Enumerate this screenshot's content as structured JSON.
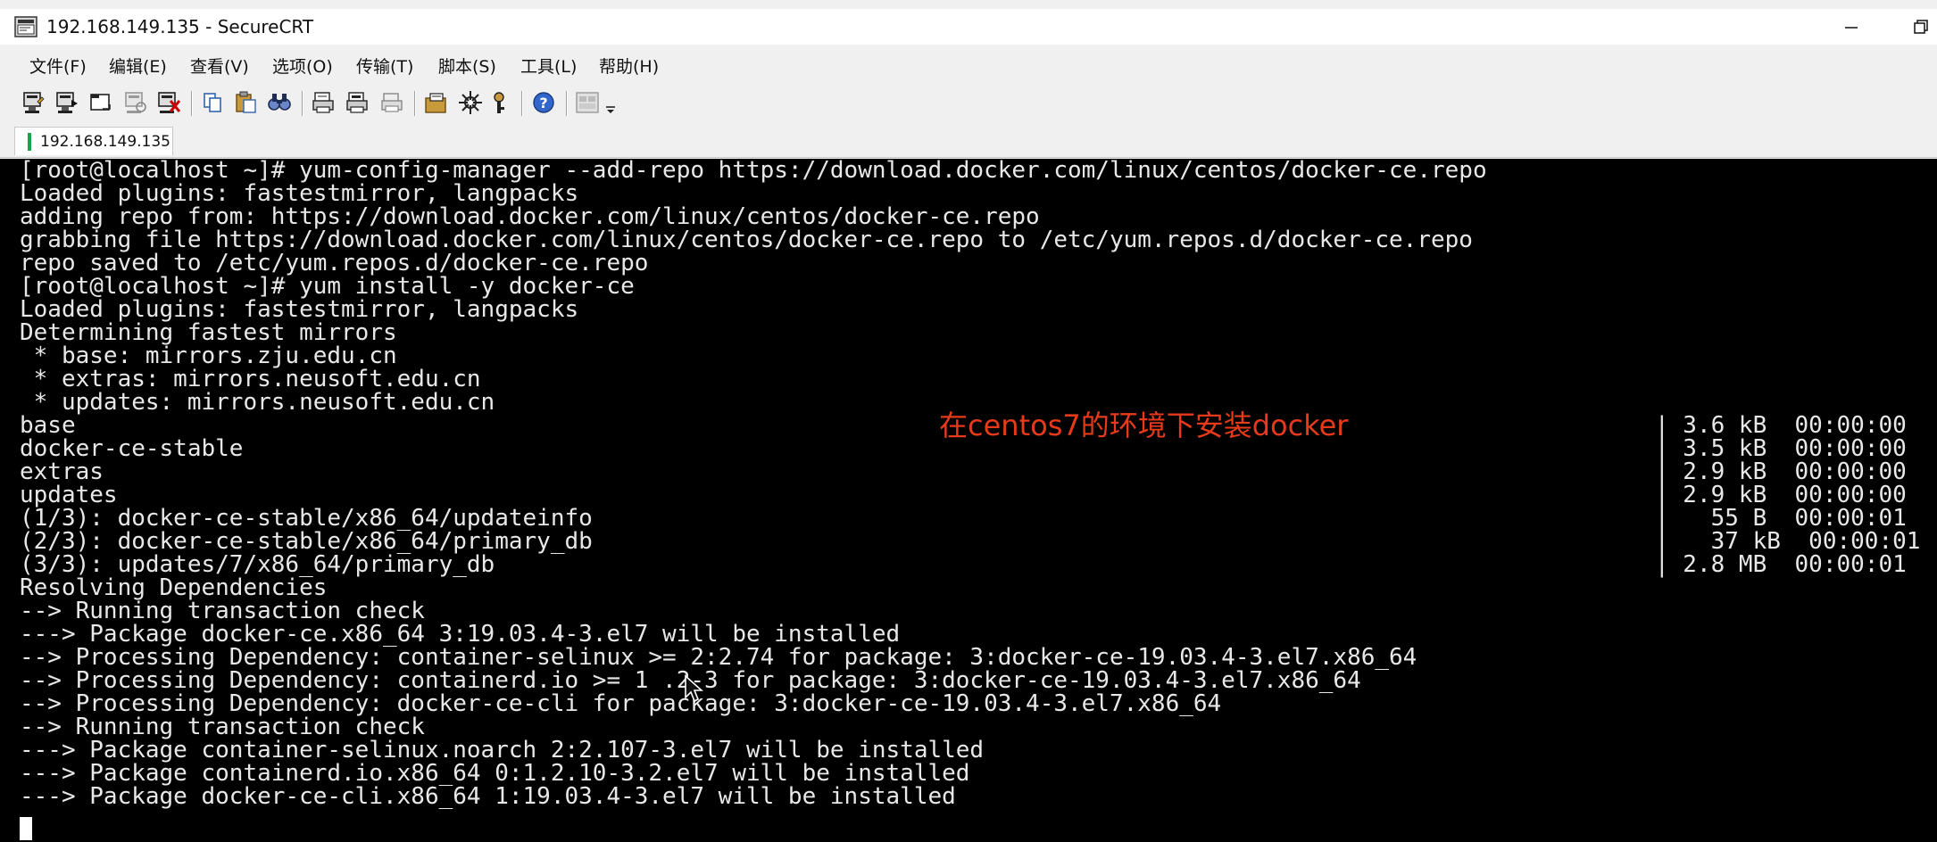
{
  "window": {
    "title": "192.168.149.135 - SecureCRT"
  },
  "menubar": {
    "items": [
      "文件(F)",
      "编辑(E)",
      "查看(V)",
      "选项(O)",
      "传输(T)",
      "脚本(S)",
      "工具(L)",
      "帮助(H)"
    ]
  },
  "toolbar": {
    "icons": [
      "connect-icon",
      "quick-connect-icon",
      "connect-in-tab-icon",
      "reconnect-icon",
      "disconnect-icon",
      "copy-icon",
      "paste-icon",
      "find-icon",
      "print-icon",
      "print-selection-icon",
      "print-setup-icon",
      "session-options-icon",
      "global-options-icon",
      "keymap-icon",
      "help-icon",
      "sftp-icon",
      "toolbar-dropdown-icon"
    ]
  },
  "tabs": [
    {
      "label": "192.168.149.135",
      "status_color": "#1aa34a"
    }
  ],
  "terminal": {
    "lines": [
      "[root@localhost ~]# yum-config-manager --add-repo https://download.docker.com/linux/centos/docker-ce.repo",
      "Loaded plugins: fastestmirror, langpacks",
      "adding repo from: https://download.docker.com/linux/centos/docker-ce.repo",
      "grabbing file https://download.docker.com/linux/centos/docker-ce.repo to /etc/yum.repos.d/docker-ce.repo",
      "repo saved to /etc/yum.repos.d/docker-ce.repo",
      "[root@localhost ~]# yum install -y docker-ce",
      "Loaded plugins: fastestmirror, langpacks",
      "Determining fastest mirrors",
      " * base: mirrors.zju.edu.cn",
      " * extras: mirrors.neusoft.edu.cn",
      " * updates: mirrors.neusoft.edu.cn",
      "base",
      "docker-ce-stable",
      "extras",
      "updates",
      "(1/3): docker-ce-stable/x86_64/updateinfo",
      "(2/3): docker-ce-stable/x86_64/primary_db",
      "(3/3): updates/7/x86_64/primary_db",
      "Resolving Dependencies",
      "--> Running transaction check",
      "---> Package docker-ce.x86_64 3:19.03.4-3.el7 will be installed",
      "--> Processing Dependency: container-selinux >= 2:2.74 for package: 3:docker-ce-19.03.4-3.el7.x86_64",
      "--> Processing Dependency: containerd.io >= 1 .2-3 for package: 3:docker-ce-19.03.4-3.el7.x86_64",
      "--> Processing Dependency: docker-ce-cli for package: 3:docker-ce-19.03.4-3.el7.x86_64",
      "--> Running transaction check",
      "---> Package container-selinux.noarch 2:2.107-3.el7 will be installed",
      "---> Package containerd.io.x86_64 0:1.2.10-3.2.el7 will be installed",
      "---> Package docker-ce-cli.x86_64 1:19.03.4-3.el7 will be installed"
    ],
    "progress_rows": [
      "| 3.6 kB  00:00:00",
      "| 3.5 kB  00:00:00",
      "| 2.9 kB  00:00:00",
      "| 2.9 kB  00:00:00",
      "|   55 B  00:00:01",
      "|   37 kB  00:00:01",
      "| 2.8 MB  00:00:01"
    ],
    "overlay_caption": "在centos7的环境下安装docker",
    "overlay_color": "#e63a1a"
  }
}
